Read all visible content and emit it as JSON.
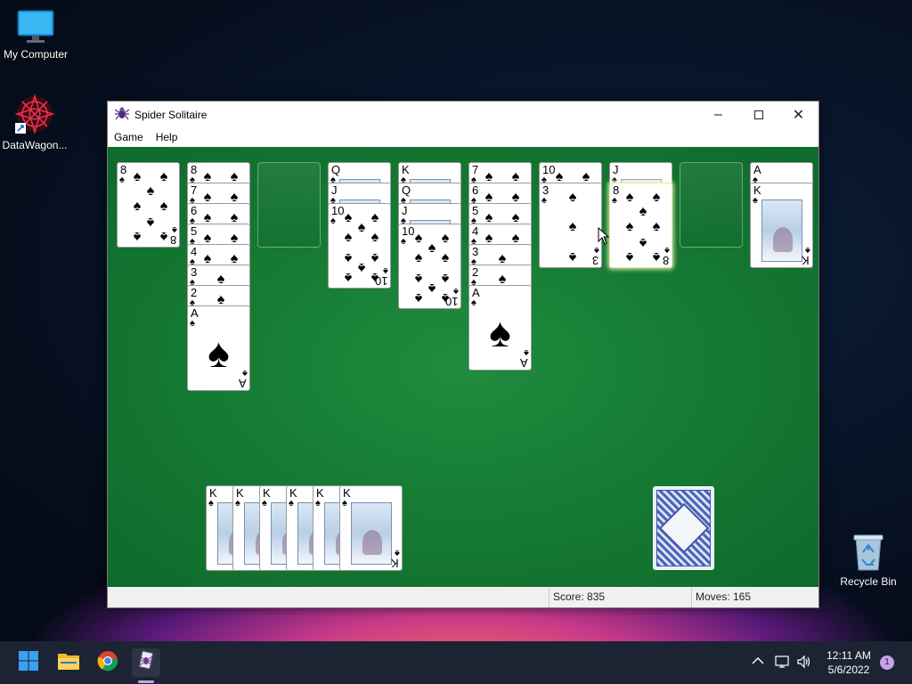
{
  "desktop": {
    "icons": [
      {
        "label": "My Computer",
        "icon": "monitor-icon"
      },
      {
        "label": "DataWagon...",
        "icon": "datawagon-shortcut-icon"
      },
      {
        "label": "Recycle Bin",
        "icon": "recycle-bin-icon"
      }
    ]
  },
  "window": {
    "title": "Spider Solitaire",
    "icon": "spider-icon",
    "controls": [
      "minimize",
      "maximize",
      "close"
    ],
    "menu": [
      "Game",
      "Help"
    ]
  },
  "columns": [
    {
      "cards": [
        {
          "rank": "8",
          "suit": "♠",
          "face": "up"
        }
      ]
    },
    {
      "cards": [
        {
          "rank": "8",
          "suit": "♠"
        },
        {
          "rank": "7",
          "suit": "♠"
        },
        {
          "rank": "6",
          "suit": "♠"
        },
        {
          "rank": "5",
          "suit": "♠"
        },
        {
          "rank": "4",
          "suit": "♠"
        },
        {
          "rank": "3",
          "suit": "♠"
        },
        {
          "rank": "2",
          "suit": "♠"
        },
        {
          "rank": "A",
          "suit": "♠"
        }
      ]
    },
    {
      "cards": []
    },
    {
      "cards": [
        {
          "rank": "Q",
          "suit": "♠"
        },
        {
          "rank": "J",
          "suit": "♠"
        },
        {
          "rank": "10",
          "suit": "♠"
        }
      ]
    },
    {
      "cards": [
        {
          "rank": "K",
          "suit": "♠"
        },
        {
          "rank": "Q",
          "suit": "♠"
        },
        {
          "rank": "J",
          "suit": "♠"
        },
        {
          "rank": "10",
          "suit": "♠"
        }
      ]
    },
    {
      "cards": [
        {
          "rank": "7",
          "suit": "♠"
        },
        {
          "rank": "6",
          "suit": "♠"
        },
        {
          "rank": "5",
          "suit": "♠"
        },
        {
          "rank": "4",
          "suit": "♠"
        },
        {
          "rank": "3",
          "suit": "♠"
        },
        {
          "rank": "2",
          "suit": "♠"
        },
        {
          "rank": "A",
          "suit": "♠"
        }
      ]
    },
    {
      "cards": [
        {
          "rank": "10",
          "suit": "♠"
        },
        {
          "rank": "3",
          "suit": "♠"
        }
      ]
    },
    {
      "cards": [
        {
          "rank": "J",
          "suit": "♠"
        },
        {
          "rank": "8",
          "suit": "♠",
          "highlighted": true
        }
      ]
    },
    {
      "cards": []
    },
    {
      "cards": [
        {
          "rank": "A",
          "suit": "♠"
        },
        {
          "rank": "K",
          "suit": "♠"
        }
      ]
    }
  ],
  "completed_stacks": {
    "count": 6,
    "top_rank": "K",
    "top_suit": "♠"
  },
  "stock": {
    "remaining_deals": 1
  },
  "status": {
    "score_label": "Score: 835",
    "moves_label": "Moves:  165"
  },
  "taskbar": {
    "apps": [
      "start-icon",
      "file-explorer-icon",
      "chrome-icon",
      "spider-solitaire-icon"
    ],
    "time": "12:11 AM",
    "date": "5/6/2022",
    "notification_count": "1"
  },
  "colors": {
    "felt": "#1a7f38",
    "accent": "#c8a2e8"
  }
}
